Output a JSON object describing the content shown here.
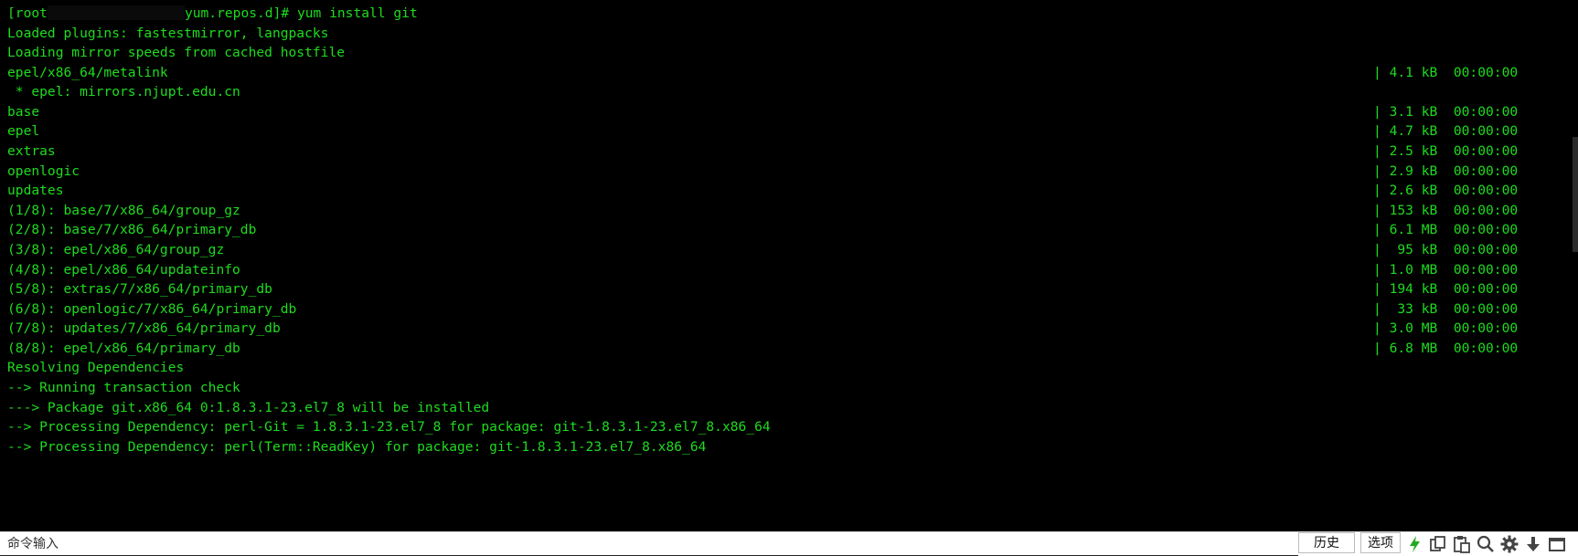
{
  "terminal": {
    "lines": [
      {
        "text": "[root",
        "extra": "yum.repos.d]# yum install git"
      },
      {
        "text": "Loaded plugins: fastestmirror, langpacks"
      },
      {
        "text": "Loading mirror speeds from cached hostfile"
      },
      {
        "text": "epel/x86_64/metalink",
        "meta": "| 4.1 kB  00:00:00"
      },
      {
        "text": " * epel: mirrors.njupt.edu.cn"
      },
      {
        "text": "base",
        "meta": "| 3.1 kB  00:00:00"
      },
      {
        "text": "epel",
        "meta": "| 4.7 kB  00:00:00"
      },
      {
        "text": "extras",
        "meta": "| 2.5 kB  00:00:00"
      },
      {
        "text": "openlogic",
        "meta": "| 2.9 kB  00:00:00"
      },
      {
        "text": "updates",
        "meta": "| 2.6 kB  00:00:00"
      },
      {
        "text": "(1/8): base/7/x86_64/group_gz",
        "meta": "| 153 kB  00:00:00"
      },
      {
        "text": "(2/8): base/7/x86_64/primary_db",
        "meta": "| 6.1 MB  00:00:00"
      },
      {
        "text": "(3/8): epel/x86_64/group_gz",
        "meta": "|  95 kB  00:00:00"
      },
      {
        "text": "(4/8): epel/x86_64/updateinfo",
        "meta": "| 1.0 MB  00:00:00"
      },
      {
        "text": "(5/8): extras/7/x86_64/primary_db",
        "meta": "| 194 kB  00:00:00"
      },
      {
        "text": "(6/8): openlogic/7/x86_64/primary_db",
        "meta": "|  33 kB  00:00:00"
      },
      {
        "text": "(7/8): updates/7/x86_64/primary_db",
        "meta": "| 3.0 MB  00:00:00"
      },
      {
        "text": "(8/8): epel/x86_64/primary_db",
        "meta": "| 6.8 MB  00:00:00"
      },
      {
        "text": "Resolving Dependencies"
      },
      {
        "text": "--> Running transaction check"
      },
      {
        "text": "---> Package git.x86_64 0:1.8.3.1-23.el7_8 will be installed"
      },
      {
        "text": "--> Processing Dependency: perl-Git = 1.8.3.1-23.el7_8 for package: git-1.8.3.1-23.el7_8.x86_64"
      },
      {
        "text": "--> Processing Dependency: perl(Term::ReadKey) for package: git-1.8.3.1-23.el7_8.x86_64"
      }
    ]
  },
  "command_bar": {
    "input_placeholder": "命令输入",
    "input_value": "",
    "history_label": "历史",
    "options_label": "选项",
    "icons": [
      "lightning-icon",
      "copy-icon",
      "paste-icon",
      "search-icon",
      "gear-icon",
      "download-icon",
      "window-icon"
    ]
  },
  "colors": {
    "terminal_bg": "#000000",
    "terminal_text": "#1edc1e",
    "accent_green": "#22aa22",
    "toolbar_bg": "#ffffff"
  }
}
